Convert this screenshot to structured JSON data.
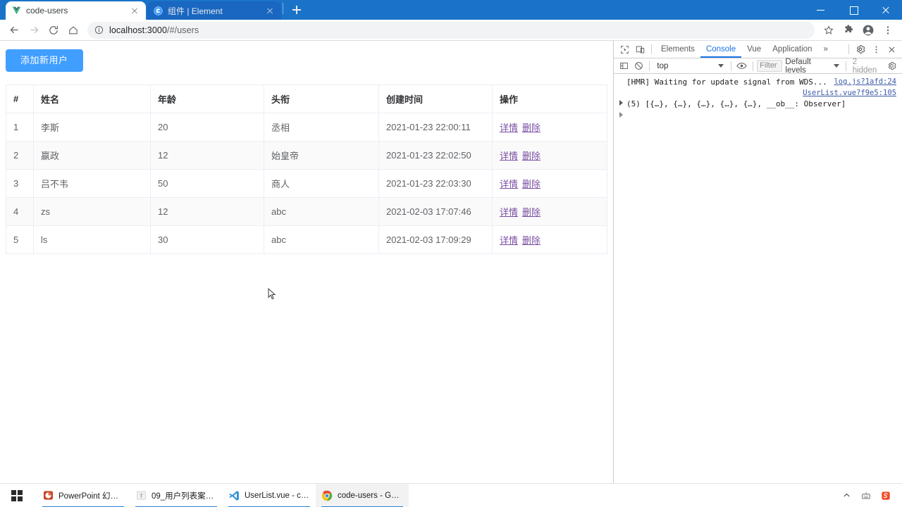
{
  "browser": {
    "tabs": [
      {
        "title": "code-users",
        "favicon": "vue-logo-icon",
        "active": true
      },
      {
        "title": "组件 | Element",
        "favicon": "element-logo-icon",
        "active": false
      }
    ],
    "new_tab_label": "+",
    "window_controls": {
      "minimize": "minimize",
      "maximize": "maximize",
      "close": "close"
    },
    "toolbar": {
      "back": "back-arrow",
      "forward": "forward-arrow",
      "reload": "reload",
      "home": "home",
      "url_prefix": "localhost:3000",
      "url_suffix": "/#/users",
      "url_full": "localhost:3000/#/users",
      "info_icon": "page-info-icon",
      "bookmark": "star-icon",
      "extensions": "puzzle-icon",
      "profile": "account-icon",
      "menu": "three-dot-menu-icon"
    }
  },
  "page": {
    "add_user_button": "添加新用户",
    "table": {
      "columns": [
        "#",
        "姓名",
        "年龄",
        "头衔",
        "创建时间",
        "操作"
      ],
      "rows": [
        {
          "id": "1",
          "name": "李斯",
          "age": "20",
          "title": "丞相",
          "created": "2021-01-23 22:00:11",
          "detail": "详情",
          "delete": "删除"
        },
        {
          "id": "2",
          "name": "嬴政",
          "age": "12",
          "title": "始皇帝",
          "created": "2021-01-23 22:02:50",
          "detail": "详情",
          "delete": "删除"
        },
        {
          "id": "3",
          "name": "吕不韦",
          "age": "50",
          "title": "商人",
          "created": "2021-01-23 22:03:30",
          "detail": "详情",
          "delete": "删除"
        },
        {
          "id": "4",
          "name": "zs",
          "age": "12",
          "title": "abc",
          "created": "2021-02-03 17:07:46",
          "detail": "详情",
          "delete": "删除"
        },
        {
          "id": "5",
          "name": "ls",
          "age": "30",
          "title": "abc",
          "created": "2021-02-03 17:09:29",
          "detail": "详情",
          "delete": "删除"
        }
      ]
    }
  },
  "devtools": {
    "inspect_icon": "inspect-element-icon",
    "device_icon": "device-toolbar-icon",
    "tabs": [
      {
        "label": "Elements",
        "active": false
      },
      {
        "label": "Console",
        "active": true
      },
      {
        "label": "Vue",
        "active": false
      },
      {
        "label": "Application",
        "active": false
      }
    ],
    "more_tabs": "»",
    "settings_icon": "gear-icon",
    "more_icon": "three-dot-menu-icon",
    "close_icon": "close-icon",
    "console_toolbar": {
      "sidebar_icon": "console-sidebar-icon",
      "clear_icon": "clear-console-icon",
      "context": "top",
      "eye_icon": "live-expression-icon",
      "filter_placeholder": "Filter",
      "levels": "Default levels",
      "hidden": "2 hidden",
      "settings_icon": "gear-icon"
    },
    "console_messages": [
      {
        "text": "[HMR] Waiting for update signal from WDS...",
        "source": "log.js?1afd:24",
        "expandable": false
      },
      {
        "text": "(5) [{…}, {…}, {…}, {…}, {…}, __ob__: Observer]",
        "source": "UserList.vue?f9e5:105",
        "expandable": true
      }
    ]
  },
  "taskbar": {
    "start": "windows-start-icon",
    "items": [
      {
        "label": "PowerPoint 幻灯...",
        "icon": "powerpoint-icon",
        "active": false
      },
      {
        "label": "09_用户列表案例...",
        "icon": "typora-icon",
        "active": false
      },
      {
        "label": "UserList.vue - co...",
        "icon": "vscode-icon",
        "active": false
      },
      {
        "label": "code-users - Goo...",
        "icon": "chrome-icon",
        "active": true
      }
    ],
    "tray": [
      {
        "icon": "chevron-up-icon"
      },
      {
        "icon": "ime-icon"
      },
      {
        "icon": "sogou-icon"
      }
    ]
  },
  "colors": {
    "accent_blue": "#409eff",
    "chrome_blue": "#1a73c8",
    "link_purple": "#7a4fa3",
    "devtools_tab_active": "#1a73e8"
  }
}
